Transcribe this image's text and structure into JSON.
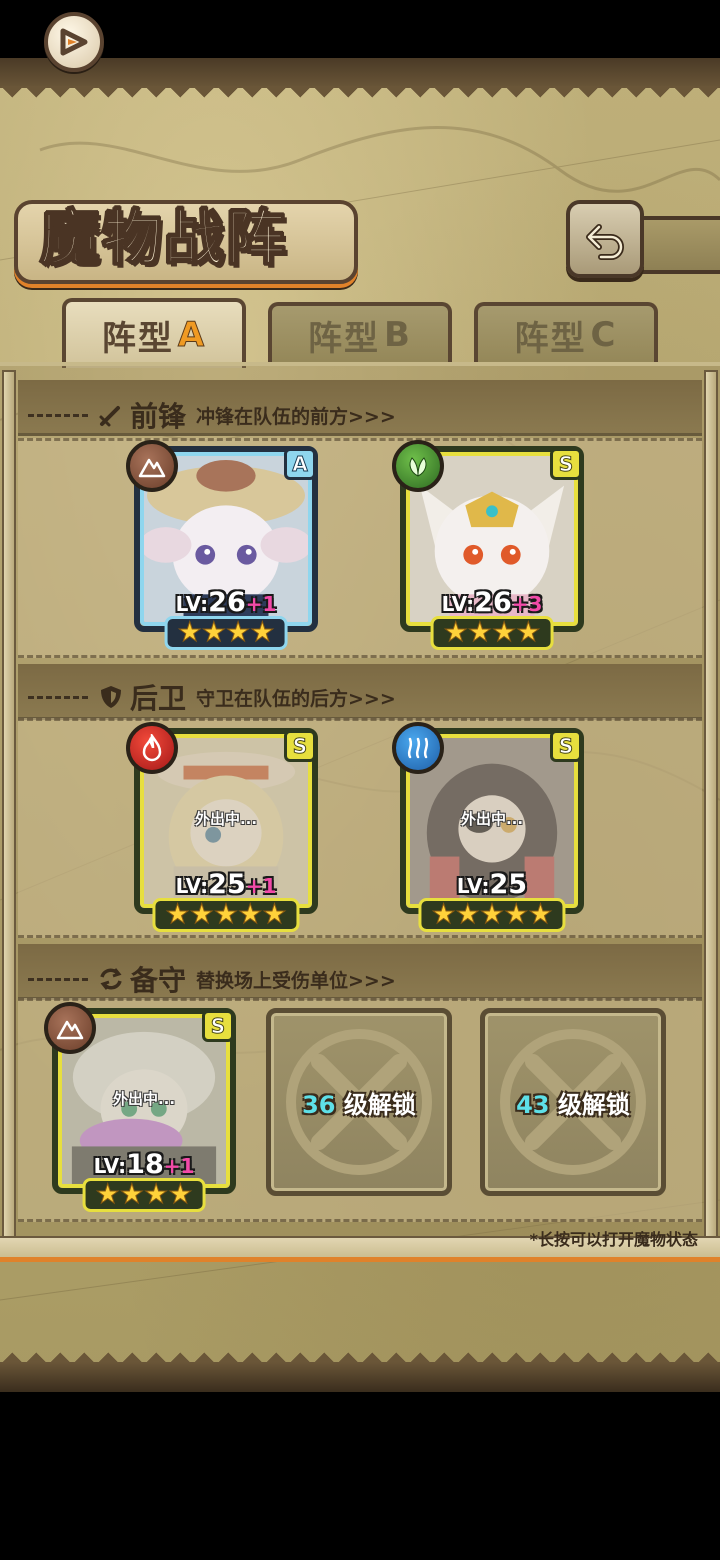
{
  "header": {
    "title": "魔物战阵",
    "map_icon": "map-pointer-icon",
    "back_icon": "back-arrow-icon"
  },
  "tabs": [
    {
      "label": "阵型",
      "letter": "A",
      "active": true
    },
    {
      "label": "阵型",
      "letter": "B",
      "active": false
    },
    {
      "label": "阵型",
      "letter": "C",
      "active": false
    }
  ],
  "sections": {
    "front": {
      "title": "前锋",
      "subtitle": "冲锋在队伍的前方>>>",
      "icon": "sword-icon"
    },
    "back": {
      "title": "后卫",
      "subtitle": "守卫在队伍的后方>>>",
      "icon": "shield-icon"
    },
    "reserve": {
      "title": "备守",
      "subtitle": "替换场上受伤单位>>>",
      "icon": "swap-icon"
    }
  },
  "cards": {
    "front_1": {
      "element": "earth",
      "rank": "A",
      "lv_prefix": "LV:",
      "level": "26",
      "bonus": "+1",
      "stars": 4,
      "away": ""
    },
    "front_2": {
      "element": "wind",
      "rank": "S",
      "lv_prefix": "LV:",
      "level": "26",
      "bonus": "+3",
      "stars": 4,
      "away": ""
    },
    "back_1": {
      "element": "fire",
      "rank": "S",
      "lv_prefix": "LV:",
      "level": "25",
      "bonus": "+1",
      "stars": 5,
      "away": "外出中..."
    },
    "back_2": {
      "element": "water",
      "rank": "S",
      "lv_prefix": "LV:",
      "level": "25",
      "bonus": "",
      "stars": 5,
      "away": "外出中..."
    },
    "reserve_1": {
      "element": "earth",
      "rank": "S",
      "lv_prefix": "LV:",
      "level": "18",
      "bonus": "+1",
      "stars": 4,
      "away": "外出中..."
    }
  },
  "locked_slots": [
    {
      "level": "36",
      "text": "级解锁"
    },
    {
      "level": "43",
      "text": "级解锁"
    }
  ],
  "footnote": "*长按可以打开魔物状态",
  "colors": {
    "rank_s": "#e7df3e",
    "rank_a": "#8fd6ee",
    "accent_orange": "#e0822a",
    "bonus_pink": "#f24aa8",
    "unlock_cyan": "#5ee0e8"
  }
}
